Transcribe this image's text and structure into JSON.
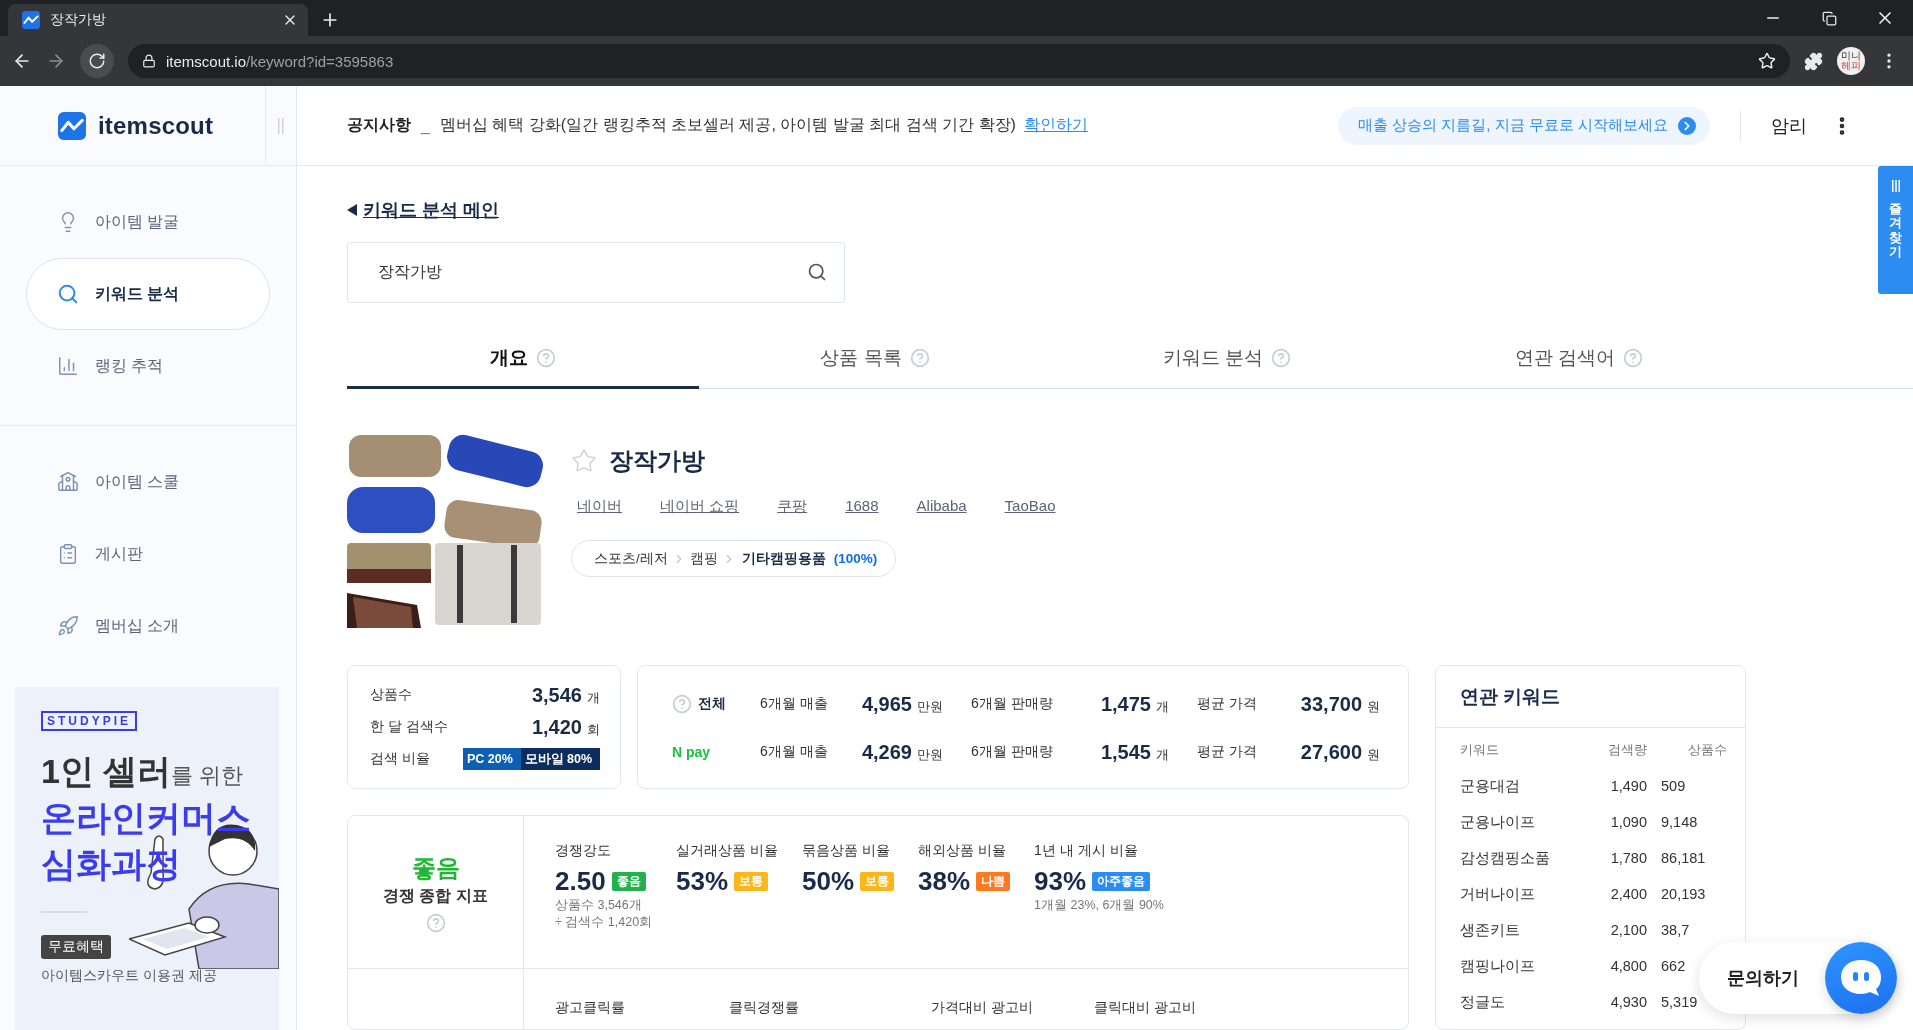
{
  "browser": {
    "tab": {
      "title": "장작가방"
    },
    "url": {
      "domain": "itemscout.io",
      "path": "/keyword?id=3595863"
    },
    "profile": {
      "line1": "미니",
      "line2": "헤피"
    }
  },
  "sidebar": {
    "logo": "itemscout",
    "nav_groups": [
      {
        "items": [
          {
            "label": "아이템 발굴",
            "kind": "bulb",
            "selected": false
          },
          {
            "label": "키워드 분석",
            "kind": "keyword",
            "selected": true
          },
          {
            "label": "랭킹 추적",
            "kind": "rank",
            "selected": false
          }
        ]
      },
      {
        "items": [
          {
            "label": "아이템 스쿨",
            "kind": "school",
            "selected": false
          },
          {
            "label": "게시판",
            "kind": "board",
            "selected": false
          },
          {
            "label": "멤버십 소개",
            "kind": "rocket",
            "selected": false
          }
        ]
      }
    ],
    "ad": {
      "brand": "STUDYPIE",
      "headline_big": "1인 셀러",
      "headline_small": "를 위한",
      "title_lines": [
        "온라인커머스",
        "심화과정"
      ],
      "badge": "무료혜택",
      "caption": "아이템스카우트 이용권 제공"
    }
  },
  "header": {
    "notice": {
      "label": "공지사항",
      "separator": "_",
      "text": "멤버십 혜택 강화(일간 랭킹추적 초보셀러 제공, 아이템 발굴 최대 검색 기간 확장)",
      "link": "확인하기"
    },
    "promo": "매출 상승의 지름길, 지금 무료로 시작해보세요",
    "user": "암리"
  },
  "favorites_tab": "즐겨찾기",
  "main": {
    "back_link": "키워드 분석 메인",
    "search": {
      "value": "장작가방"
    },
    "tabs": [
      {
        "label": "개요",
        "selected": true
      },
      {
        "label": "상품 목록",
        "selected": false
      },
      {
        "label": "키워드 분석",
        "selected": false
      },
      {
        "label": "연관 검색어",
        "selected": false
      }
    ],
    "keyword": {
      "title": "장작가방",
      "starred": false,
      "links": [
        "네이버",
        "네이버 쇼핑",
        "쿠팡",
        "1688",
        "Alibaba",
        "TaoBao"
      ],
      "category": {
        "path": [
          "스포츠/레저",
          "캠핑"
        ],
        "leaf": "기타캠핑용품",
        "share": "(100%)"
      }
    },
    "summary": {
      "rows": [
        {
          "label": "상품수",
          "value": "3,546",
          "unit": "개"
        },
        {
          "label": "한 달 검색수",
          "value": "1,420",
          "unit": "회"
        }
      ],
      "ratio": {
        "label": "검색 비율",
        "pc": "PC 20%",
        "mobile": "모바일 80%"
      }
    },
    "sales": [
      {
        "kind": "all",
        "label": "전체",
        "metrics": [
          {
            "label": "6개월 매출",
            "value": "4,965",
            "unit": "만원"
          },
          {
            "label": "6개월 판매량",
            "value": "1,475",
            "unit": "개"
          },
          {
            "label": "평균 가격",
            "value": "33,700",
            "unit": "원"
          }
        ]
      },
      {
        "kind": "npay",
        "label": "N pay",
        "metrics": [
          {
            "label": "6개월 매출",
            "value": "4,269",
            "unit": "만원"
          },
          {
            "label": "6개월 판매량",
            "value": "1,545",
            "unit": "개"
          },
          {
            "label": "평균 가격",
            "value": "27,600",
            "unit": "원"
          }
        ]
      }
    ],
    "competition": {
      "overall": {
        "grade": "좋음",
        "label": "경쟁 종합 지표"
      },
      "metrics": [
        {
          "label": "경쟁강도",
          "value": "2.50",
          "badge": "좋음",
          "color": "#22b14c",
          "notes": [
            "상품수 3,546개",
            "÷ 검색수 1,420회"
          ]
        },
        {
          "label": "실거래상품 비율",
          "value": "53%",
          "badge": "보통",
          "color": "#fbb619"
        },
        {
          "label": "묶음상품 비율",
          "value": "50%",
          "badge": "보통",
          "color": "#fbb619"
        },
        {
          "label": "해외상품 비율",
          "value": "38%",
          "badge": "나쁨",
          "color": "#fd7a20"
        },
        {
          "label": "1년 내 게시 비율",
          "value": "93%",
          "badge": "아주좋음",
          "color": "#2b8cf5",
          "notes": [
            "1개월 23%, 6개월 90%"
          ]
        }
      ],
      "ad_metrics": [
        "광고클릭률",
        "클릭경쟁률",
        "가격대비 광고비",
        "클릭대비 광고비"
      ]
    },
    "related": {
      "title": "연관 키워드",
      "columns": [
        "키워드",
        "검색량",
        "상품수"
      ],
      "rows": [
        [
          "군용대검",
          "1,490",
          "509"
        ],
        [
          "군용나이프",
          "1,090",
          "9,148"
        ],
        [
          "감성캠핑소품",
          "1,780",
          "86,181"
        ],
        [
          "거버나이프",
          "2,400",
          "20,193"
        ],
        [
          "생존키트",
          "2,100",
          "38,7"
        ],
        [
          "캠핑나이프",
          "4,800",
          "662"
        ],
        [
          "정글도",
          "4,930",
          "5,319"
        ]
      ]
    }
  },
  "chat": {
    "label": "문의하기"
  }
}
